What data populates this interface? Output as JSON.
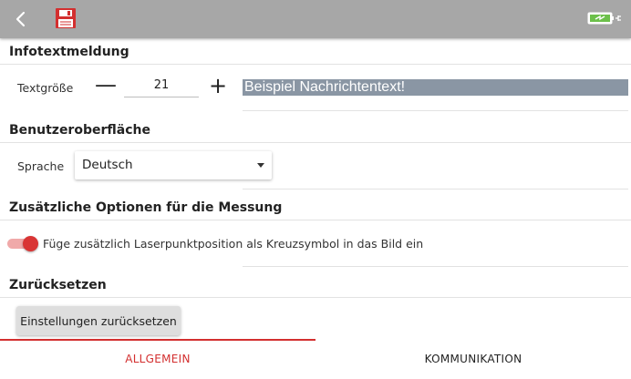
{
  "toolbar": {
    "icons": [
      "back-icon",
      "save-icon",
      "battery-charging-icon"
    ],
    "colors": {
      "bar": "#a7a7a7",
      "save_icon": "#d32f2f",
      "battery": "#6cc04a"
    }
  },
  "info_section": {
    "title": "Infotextmeldung",
    "text_size_label": "Textgröße",
    "decrement_label": "—",
    "text_size_value": "21",
    "increment_label": "+",
    "preview_text": "Beispiel Nachrichtentext!",
    "preview_background": "#8a96a4"
  },
  "ui_section": {
    "title": "Benutzeroberfläche",
    "language_label": "Sprache",
    "language_value": "Deutsch"
  },
  "measure_section": {
    "title": "Zusätzliche Optionen für die Messung",
    "laser_toggle_label": "Füge zusätzlich Laserpunktposition als Kreuzsymbol in das Bild ein",
    "laser_toggle_on": true,
    "toggle_color": "#d93535"
  },
  "reset_section": {
    "title": "Zurücksetzen",
    "reset_button_label": "Einstellungen zurücksetzen"
  },
  "tabs": [
    {
      "label": "ALLGEMEIN",
      "active": true
    },
    {
      "label": "KOMMUNIKATION",
      "active": false
    }
  ],
  "accent_color": "#d32f2f"
}
